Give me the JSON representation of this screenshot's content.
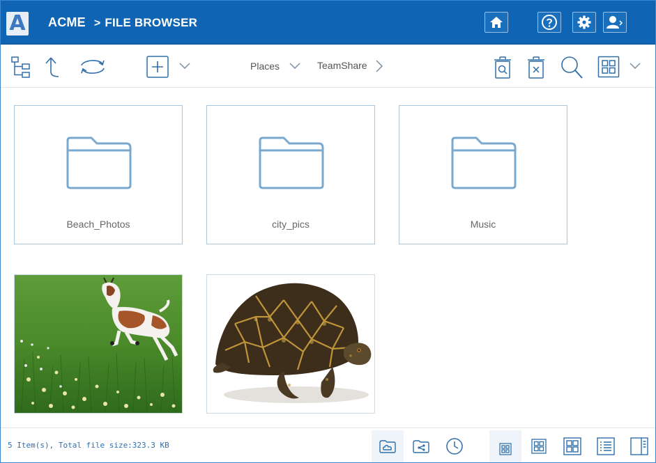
{
  "header": {
    "brand": "ACME",
    "separator": ">",
    "title": "FILE BROWSER",
    "logo_letter": "A"
  },
  "toolbar": {
    "places_label": "Places",
    "teamshare_label": "TeamShare"
  },
  "items": [
    {
      "name": "Beach_Photos",
      "type": "folder"
    },
    {
      "name": "city_pics",
      "type": "folder"
    },
    {
      "name": "Music",
      "type": "folder"
    },
    {
      "name": "goat",
      "type": "image"
    },
    {
      "name": "turtle",
      "type": "image"
    }
  ],
  "status": {
    "summary": "5 Item(s), Total file size:323.3 KB"
  },
  "colors": {
    "header_bg": "#0f65b3",
    "accent": "#2d6fb3",
    "folder_stroke": "#7aa9d0",
    "icon_stroke": "#2f6ea8"
  }
}
